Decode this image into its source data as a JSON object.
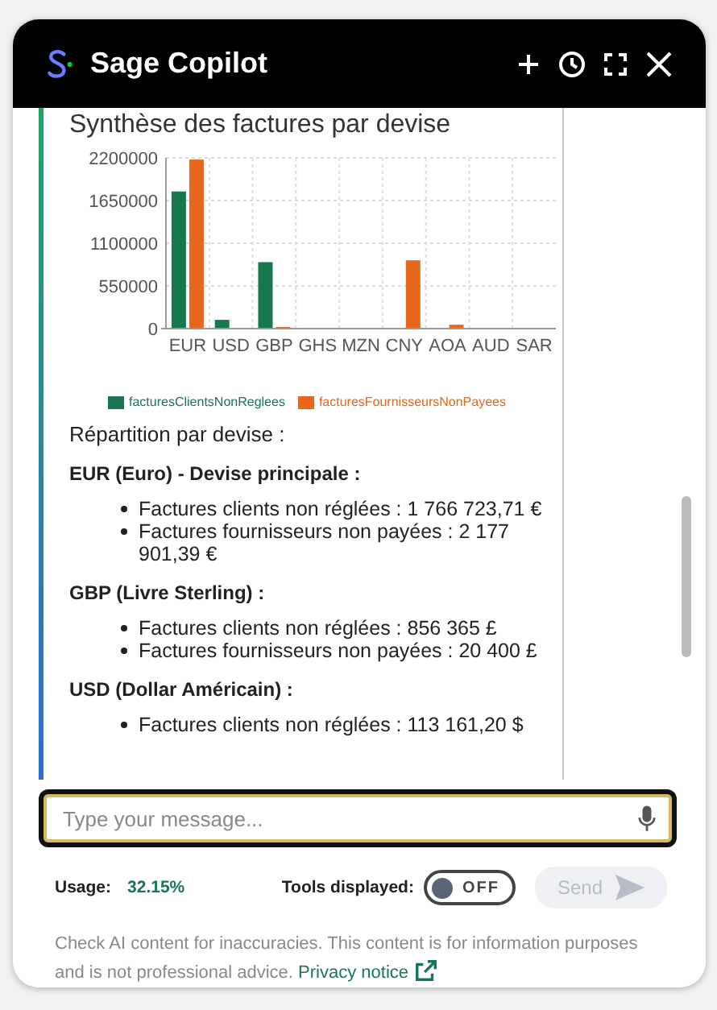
{
  "header": {
    "title": "Sage Copilot"
  },
  "message": {
    "chart_title": "Synthèse des factures par devise",
    "chart_data": {
      "type": "bar",
      "grid": true,
      "legend": "bottom",
      "categories": [
        "EUR",
        "USD",
        "GBP",
        "GHS",
        "MZN",
        "CNY",
        "AOA",
        "AUD",
        "SAR"
      ],
      "ylim": [
        0,
        2200000
      ],
      "yticks": [
        0,
        550000,
        1100000,
        1650000,
        2200000
      ],
      "series": [
        {
          "name": "facturesClientsNonReglees",
          "color": "#17784f",
          "values": [
            1767000,
            113000,
            856000,
            0,
            0,
            0,
            0,
            0,
            0
          ]
        },
        {
          "name": "facturesFournisseursNonPayees",
          "color": "#e8671c",
          "values": [
            2178000,
            0,
            20000,
            0,
            0,
            880000,
            50000,
            0,
            0
          ]
        }
      ]
    },
    "intro": "Répartition par devise :",
    "sections": [
      {
        "heading": "EUR (Euro) - Devise principale :",
        "items": [
          "Factures clients non réglées : 1 766 723,71 €",
          "Factures fournisseurs non payées : 2 177 901,39 €"
        ]
      },
      {
        "heading": "GBP (Livre Sterling) :",
        "items": [
          "Factures clients non réglées : 856 365 £",
          "Factures fournisseurs non payées : 20 400 £"
        ]
      },
      {
        "heading": "USD (Dollar Américain) :",
        "items": [
          "Factures clients non réglées : 113 161,20 $"
        ]
      }
    ]
  },
  "input": {
    "placeholder": "Type your message..."
  },
  "usage": {
    "label": "Usage:",
    "value": "32.15%"
  },
  "tools": {
    "label": "Tools displayed:",
    "toggle": "OFF",
    "on": false
  },
  "send": {
    "label": "Send",
    "disabled": true
  },
  "disclaimer": {
    "text": "Check AI content for inaccuracies. This content is for information purposes and is not professional advice.",
    "link": "Privacy notice"
  }
}
